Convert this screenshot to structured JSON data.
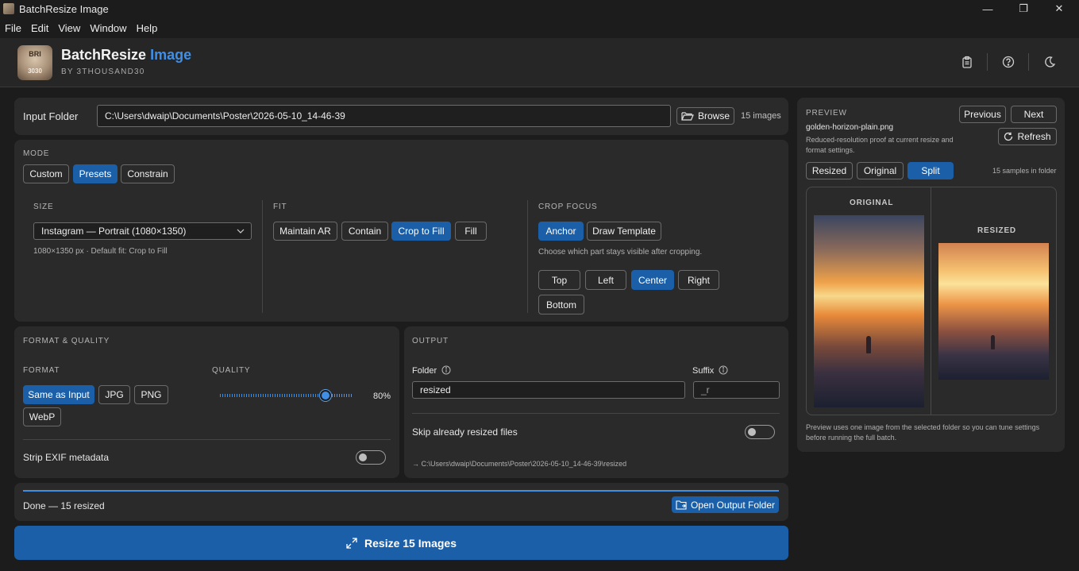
{
  "window": {
    "title": "BatchResize Image",
    "minimize": "—",
    "maximize": "❐",
    "close": "✕"
  },
  "menu": [
    "File",
    "Edit",
    "View",
    "Window",
    "Help"
  ],
  "header": {
    "logo_text": "BRI",
    "logo_sub": "3030",
    "brand_main": "BatchResize",
    "brand_accent": "Image",
    "byline": "BY 3THOUSAND30"
  },
  "input": {
    "label": "Input Folder",
    "path": "C:\\Users\\dwaip\\Documents\\Poster\\2026-05-10_14-46-39",
    "browse": "Browse",
    "count": "15 images"
  },
  "mode": {
    "label": "MODE",
    "tabs": [
      "Custom",
      "Presets",
      "Constrain"
    ],
    "active": "Presets",
    "size_label": "SIZE",
    "size_value": "Instagram — Portrait (1080×1350)",
    "size_hint": "1080×1350 px  ·  Default fit: Crop to Fill",
    "fit_label": "FIT",
    "fit_options": [
      "Maintain AR",
      "Contain",
      "Crop to Fill",
      "Fill"
    ],
    "fit_active": "Crop to Fill",
    "crop_label": "CROP FOCUS",
    "crop_modes": [
      "Anchor",
      "Draw Template"
    ],
    "crop_mode_active": "Anchor",
    "crop_hint": "Choose which part stays visible after cropping.",
    "anchors": [
      "Top",
      "Left",
      "Center",
      "Right",
      "Bottom"
    ],
    "anchor_active": "Center"
  },
  "format": {
    "label": "FORMAT & QUALITY",
    "format_label": "FORMAT",
    "options": [
      "Same as Input",
      "JPG",
      "PNG",
      "WebP"
    ],
    "active": "Same as Input",
    "quality_label": "QUALITY",
    "quality_value": 80,
    "quality_text": "80%",
    "strip_exif": "Strip EXIF metadata",
    "strip_exif_on": false
  },
  "output": {
    "label": "OUTPUT",
    "folder_label": "Folder",
    "folder_value": "resized",
    "suffix_label": "Suffix",
    "suffix_value": "_r",
    "skip_label": "Skip already resized files",
    "skip_on": false,
    "dest_path": "→ C:\\Users\\dwaip\\Documents\\Poster\\2026-05-10_14-46-39\\resized"
  },
  "status": {
    "text": "Done — 15 resized",
    "progress": 1.0,
    "open_button": "Open Output Folder"
  },
  "action": {
    "label": "Resize 15 Images"
  },
  "preview": {
    "label": "PREVIEW",
    "filename": "golden-horizon-plain.png",
    "desc": "Reduced-resolution proof at current resize and format settings.",
    "prev": "Previous",
    "next": "Next",
    "refresh": "Refresh",
    "views": [
      "Resized",
      "Original",
      "Split"
    ],
    "view_active": "Split",
    "samples": "15 samples in folder",
    "original_caption": "ORIGINAL",
    "resized_caption": "RESIZED",
    "note": "Preview uses one image from the selected folder so you can tune settings before running the full batch."
  },
  "colors": {
    "accent": "#1a5fa8",
    "brand_accent": "#3f8fe6",
    "background": "#1c1c1c",
    "panel": "#2a2a2a"
  }
}
